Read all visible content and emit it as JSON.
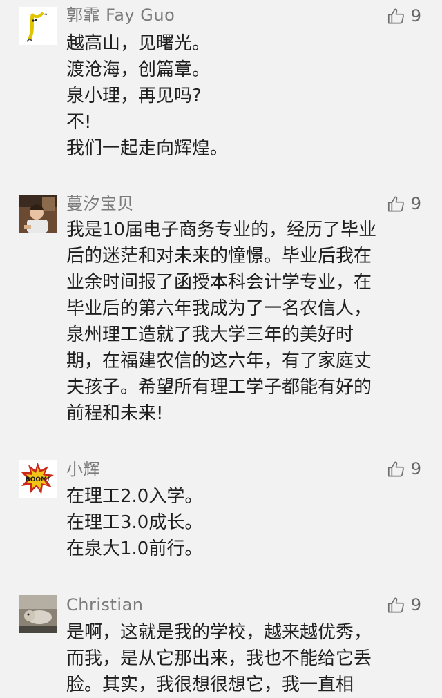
{
  "comments": [
    {
      "username": "郭霏 Fay Guo",
      "avatar_icon": "banana-cartoon-avatar",
      "like_icon": "thumbs-up-icon",
      "likes": "9",
      "lines": [
        "越高山，见曙光。",
        "渡沧海，创篇章。",
        "泉小理，再见吗?",
        "不!",
        "我们一起走向辉煌。"
      ]
    },
    {
      "username": "蔓汐宝贝",
      "avatar_icon": "child-photo-avatar",
      "like_icon": "thumbs-up-icon",
      "likes": "9",
      "lines": [
        "我是10届电子商务专业的，经历了毕业",
        "后的迷茫和对未来的憧憬。毕业后我在",
        "业余时间报了函授本科会计学专业，在",
        "毕业后的第六年我成为了一名农信人，",
        "泉州理工造就了我大学三年的美好时",
        "期，在福建农信的这六年，有了家庭丈",
        "夫孩子。希望所有理工学子都能有好的",
        "前程和未来!"
      ]
    },
    {
      "username": "小辉",
      "avatar_icon": "boom-comic-avatar",
      "avatar_text": "BOOM!",
      "like_icon": "thumbs-up-icon",
      "likes": "9",
      "lines": [
        "在理工2.0入学。",
        "在理工3.0成长。",
        "在泉大1.0前行。"
      ]
    },
    {
      "username": "Christian",
      "avatar_icon": "pet-photo-avatar",
      "like_icon": "thumbs-up-icon",
      "likes": "9",
      "lines": [
        "是啊，这就是我的学校，越来越优秀，",
        "而我，是从它那出来，我也不能给它丢",
        "脸。其实，我很想很想它，我一直相"
      ]
    }
  ]
}
